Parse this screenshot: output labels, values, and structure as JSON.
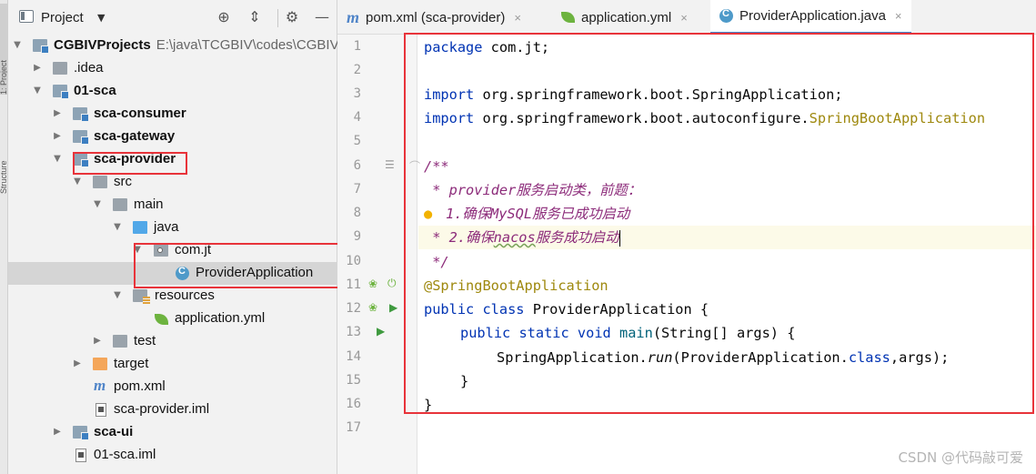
{
  "tool_strip": {
    "tab_top": "1: Project",
    "tab_mid": "Structure"
  },
  "project_panel": {
    "title": "Project",
    "icons": [
      "target-icon",
      "collapse-icon",
      "gear-icon",
      "minimize-icon"
    ],
    "tree": [
      {
        "label": "CGBIVProjects",
        "path": "E:\\java\\TCGBIV\\codes\\CGBIV",
        "bold": true
      },
      {
        "label": ".idea",
        "bold": false
      },
      {
        "label": "01-sca",
        "bold": true
      },
      {
        "label": "sca-consumer",
        "bold": true
      },
      {
        "label": "sca-gateway",
        "bold": true
      },
      {
        "label": "sca-provider",
        "bold": true
      },
      {
        "label": "src",
        "bold": false
      },
      {
        "label": "main",
        "bold": false
      },
      {
        "label": "java",
        "bold": false
      },
      {
        "label": "com.jt",
        "bold": false
      },
      {
        "label": "ProviderApplication",
        "bold": false
      },
      {
        "label": "resources",
        "bold": false
      },
      {
        "label": "application.yml",
        "bold": false
      },
      {
        "label": "test",
        "bold": false
      },
      {
        "label": "target",
        "bold": false
      },
      {
        "label": "pom.xml",
        "bold": false
      },
      {
        "label": "sca-provider.iml",
        "bold": false
      },
      {
        "label": "sca-ui",
        "bold": true
      },
      {
        "label": "01-sca.iml",
        "bold": false
      }
    ]
  },
  "tabs": [
    {
      "label": "pom.xml (sca-provider)",
      "close": "×"
    },
    {
      "label": "application.yml",
      "close": "×"
    },
    {
      "label": "ProviderApplication.java",
      "close": "×"
    }
  ],
  "gutter": {
    "line_numbers": [
      "1",
      "2",
      "3",
      "4",
      "5",
      "6",
      "7",
      "8",
      "9",
      "10",
      "11",
      "12",
      "13",
      "14",
      "15",
      "16",
      "17"
    ]
  },
  "code": {
    "l1_kw": "package",
    "l1_rest": " com.jt;",
    "l3_kw": "import",
    "l3_rest": " org.springframework.boot.SpringApplication;",
    "l4_kw": "import",
    "l4_rest": " org.springframework.boot.autoconfigure.",
    "l4_ann": "SpringBootApplication",
    "l6": "/**",
    "l7_star": " * ",
    "l7_doc": "provider服务启动类，前题：",
    "l8_doc": "1.确保MySQL服务已成功启动",
    "l9_star": " * ",
    "l9_doc_a": "2.确保",
    "l9_doc_b": "nacos",
    "l9_doc_c": "服务成功启动",
    "l10": " */",
    "l11": "@SpringBootApplication",
    "l12_kw": "public class",
    "l12_rest": " ProviderApplication {",
    "l13_kw": "public static void",
    "l13_fn": " main",
    "l13_rest": "(String[] args) {",
    "l14_a": "SpringApplication.",
    "l14_b": "run",
    "l14_c": "(ProviderApplication.",
    "l14_d": "class",
    "l14_e": ",args);",
    "l15": "}",
    "l16": "}"
  },
  "watermark": "CSDN @代码敲可爱",
  "colors": {
    "highlight_box": "#e8333a",
    "keyword": "#0033b3",
    "annotation": "#9e880d",
    "doc": "#8c2b7a"
  }
}
